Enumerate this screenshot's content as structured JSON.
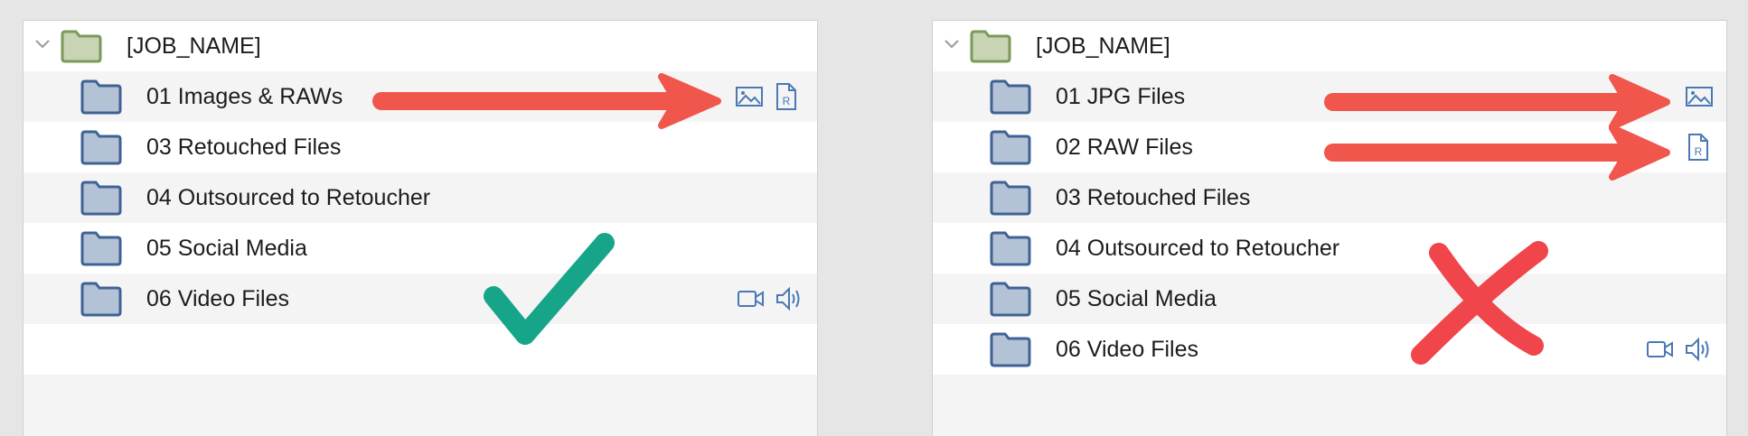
{
  "panels": [
    {
      "rows": [
        {
          "label": "[JOB_NAME]",
          "type": "job",
          "icons": []
        },
        {
          "label": "01 Images & RAWs",
          "type": "folder",
          "icons": [
            "image-icon",
            "raw-file-icon"
          ]
        },
        {
          "label": "03 Retouched Files",
          "type": "folder",
          "icons": []
        },
        {
          "label": "04 Outsourced to Retoucher",
          "type": "folder",
          "icons": []
        },
        {
          "label": "05 Social Media",
          "type": "folder",
          "icons": []
        },
        {
          "label": "06 Video Files",
          "type": "folder",
          "icons": [
            "video-icon",
            "audio-icon"
          ]
        }
      ],
      "verdict": "checkmark"
    },
    {
      "rows": [
        {
          "label": "[JOB_NAME]",
          "type": "job",
          "icons": []
        },
        {
          "label": "01 JPG Files",
          "type": "folder",
          "icons": [
            "image-icon"
          ]
        },
        {
          "label": "02 RAW Files",
          "type": "folder",
          "icons": [
            "raw-file-icon"
          ]
        },
        {
          "label": "03 Retouched Files",
          "type": "folder",
          "icons": []
        },
        {
          "label": "04 Outsourced to Retoucher",
          "type": "folder",
          "icons": []
        },
        {
          "label": "05 Social Media",
          "type": "folder",
          "icons": []
        },
        {
          "label": "06 Video Files",
          "type": "folder",
          "icons": [
            "video-icon",
            "audio-icon"
          ]
        }
      ],
      "verdict": "cross"
    }
  ],
  "raw_icon_letter": "R",
  "colors": {
    "folder_fill": "#b4c2d6",
    "folder_stroke": "#3f6295",
    "job_folder_fill": "#c8d4b4",
    "job_folder_stroke": "#7a9a5a",
    "arrow": "#f0564b",
    "check": "#17a58a",
    "cross": "#f0454a",
    "icon_blue": "#4a78b5"
  }
}
